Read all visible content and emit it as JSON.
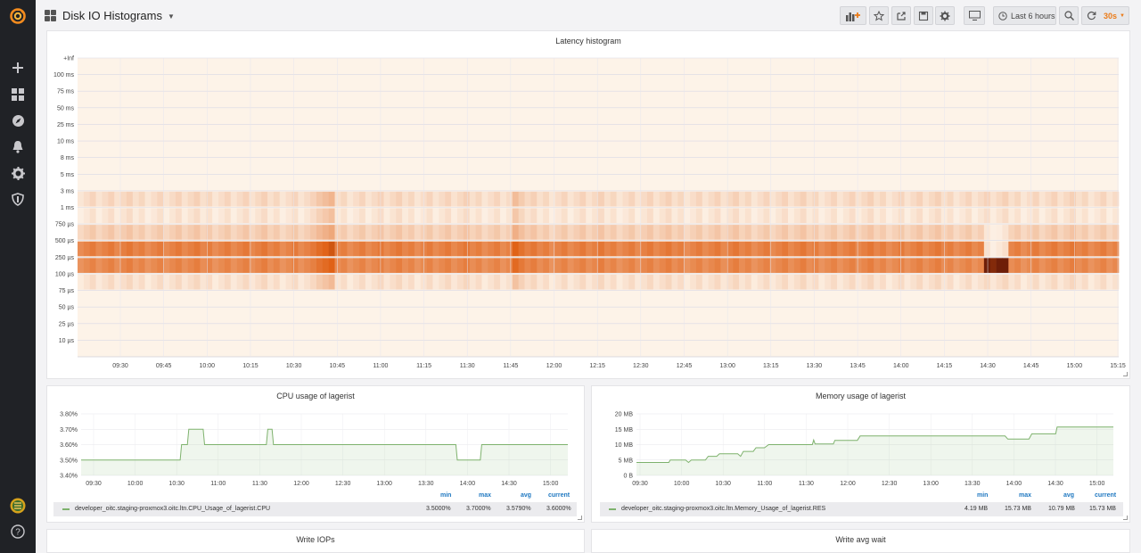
{
  "dashboard": {
    "title": "Disk IO Histograms"
  },
  "sidebar": {
    "items": [
      {
        "name": "grafana-logo-icon"
      },
      {
        "name": "create-icon"
      },
      {
        "name": "dashboards-icon"
      },
      {
        "name": "explore-icon"
      },
      {
        "name": "alerting-icon"
      },
      {
        "name": "configuration-icon"
      },
      {
        "name": "server-admin-icon"
      },
      {
        "name": "user-avatar"
      },
      {
        "name": "help-icon"
      }
    ]
  },
  "toolbar": {
    "time_range": "Last 6 hours",
    "refresh_interval": "30s",
    "accent": "#eb7b18"
  },
  "heatmap": {
    "title": "Latency histogram",
    "y_labels": [
      "+Inf",
      "100 ms",
      "75 ms",
      "50 ms",
      "25 ms",
      "10 ms",
      "8 ms",
      "5 ms",
      "3 ms",
      "1 ms",
      "750 µs",
      "500 µs",
      "250 µs",
      "100 µs",
      "75 µs",
      "50 µs",
      "25 µs",
      "10 µs"
    ],
    "x_labels": [
      "09:30",
      "09:45",
      "10:00",
      "10:15",
      "10:30",
      "10:45",
      "11:00",
      "11:15",
      "11:30",
      "11:45",
      "12:00",
      "12:15",
      "12:30",
      "12:45",
      "13:00",
      "13:15",
      "13:30",
      "13:45",
      "14:00",
      "14:15",
      "14:30",
      "14:45",
      "15:00",
      "15:15"
    ]
  },
  "cpu_panel": {
    "title": "CPU usage of lagerist",
    "y_labels": [
      "3.80%",
      "3.70%",
      "3.60%",
      "3.50%",
      "3.40%"
    ],
    "x_labels": [
      "09:30",
      "10:00",
      "10:30",
      "11:00",
      "11:30",
      "12:00",
      "12:30",
      "13:00",
      "13:30",
      "14:00",
      "14:30",
      "15:00"
    ],
    "legend_headers": {
      "min": "min",
      "max": "max",
      "avg": "avg",
      "current": "current"
    },
    "series_name": "developer_oitc.staging-proxmox3.oitc.ltn.CPU_Usage_of_lagerist.CPU",
    "stats": {
      "min": "3.5000%",
      "max": "3.7000%",
      "avg": "3.5790%",
      "current": "3.6000%"
    },
    "color": "#7eb26d"
  },
  "mem_panel": {
    "title": "Memory usage of lagerist",
    "y_labels": [
      "20 MB",
      "15 MB",
      "10 MB",
      "5 MB",
      "0 B"
    ],
    "x_labels": [
      "09:30",
      "10:00",
      "10:30",
      "11:00",
      "11:30",
      "12:00",
      "12:30",
      "13:00",
      "13:30",
      "14:00",
      "14:30",
      "15:00"
    ],
    "legend_headers": {
      "min": "min",
      "max": "max",
      "avg": "avg",
      "current": "current"
    },
    "series_name": "developer_oitc.staging-proxmox3.oitc.ltn.Memory_Usage_of_lagerist.RES",
    "stats": {
      "min": "4.19 MB",
      "max": "15.73 MB",
      "avg": "10.79 MB",
      "current": "15.73 MB"
    },
    "color": "#7eb26d"
  },
  "bottom_panels": {
    "left_title": "Write IOPs",
    "right_title": "Write avg wait"
  }
}
